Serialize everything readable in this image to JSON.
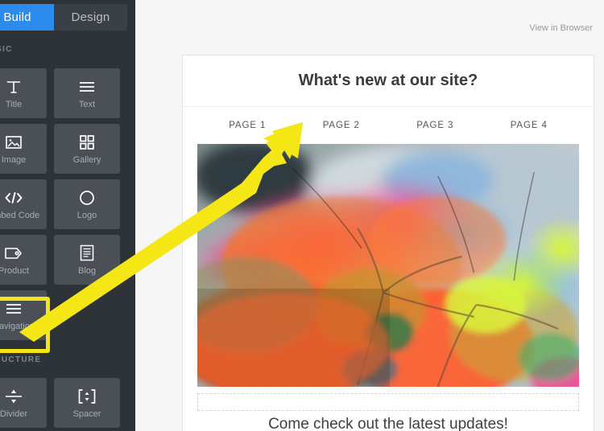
{
  "sidebar": {
    "tabs": [
      {
        "label": "Build",
        "active": true
      },
      {
        "label": "Design",
        "active": false
      }
    ],
    "sections": [
      {
        "label": "BASIC"
      },
      {
        "label": "STRUCTURE"
      }
    ],
    "elements": [
      {
        "label": "Title",
        "icon": "title-icon"
      },
      {
        "label": "Text",
        "icon": "text-lines-icon"
      },
      {
        "label": "Image",
        "icon": "image-icon"
      },
      {
        "label": "Gallery",
        "icon": "gallery-grid-icon"
      },
      {
        "label": "Embed Code",
        "icon": "code-brackets-icon"
      },
      {
        "label": "Logo",
        "icon": "circle-logo-icon"
      },
      {
        "label": "Product",
        "icon": "tag-product-icon"
      },
      {
        "label": "Blog",
        "icon": "blog-document-icon"
      },
      {
        "label": "Navigation",
        "icon": "navigation-lines-icon"
      },
      {
        "label": "Divider",
        "icon": "divider-icon"
      },
      {
        "label": "Spacer",
        "icon": "spacer-icon"
      }
    ],
    "highlighted_element": "Navigation"
  },
  "canvas": {
    "view_in_browser": "View in Browser",
    "site_title": "What's new at our site?",
    "page_nav": [
      "PAGE 1",
      "PAGE 2",
      "PAGE 3",
      "PAGE 4"
    ],
    "hero_alt": "abstract-colorful-artwork",
    "tagline": "Come check out the latest updates!"
  },
  "annotation": {
    "arrow_color": "#f5e616",
    "highlight_color": "#f5e616",
    "points_from": "Navigation",
    "points_to": "page-navigation-bar"
  },
  "colors": {
    "accent_blue": "#2b8cee",
    "sidebar_bg": "#2e3338",
    "tile_bg": "#4a5056",
    "canvas_bg": "#f6f6f6"
  }
}
